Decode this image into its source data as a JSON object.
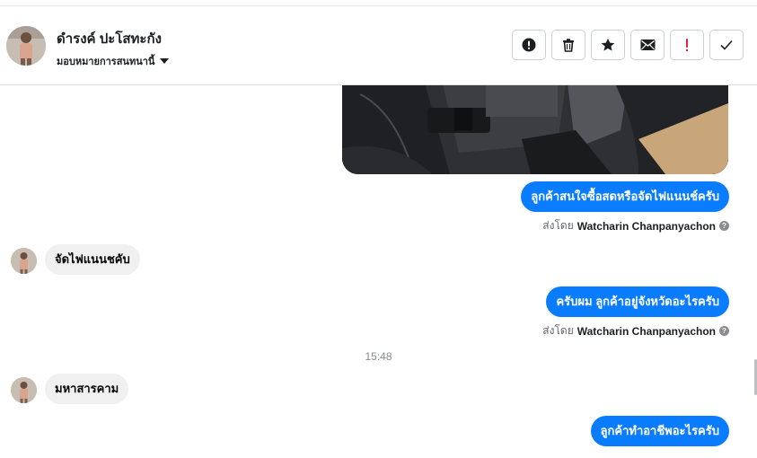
{
  "header": {
    "contact_name": "ดำรงค์ ปะโสทะกัง",
    "assign_label": "มอบหมายการสนทนานี้"
  },
  "actions": [
    {
      "icon": "alert-circle-icon",
      "label": "Mark as spam"
    },
    {
      "icon": "trash-icon",
      "label": "Delete"
    },
    {
      "icon": "star-icon",
      "label": "Star"
    },
    {
      "icon": "envelope-icon",
      "label": "Mark as unread"
    },
    {
      "icon": "exclamation-icon",
      "label": "Follow up"
    },
    {
      "icon": "checkmark-icon",
      "label": "Mark as done"
    }
  ],
  "messages": {
    "out_1": "ลูกค้าสนใจซื้อสดหรือจัดไฟแนนช์ครับ",
    "sent_by_prefix_1": "ส่งโดย",
    "sent_by_name_1": "Watcharin Chanpanyachon",
    "in_1": "จัดไฟแนนชคับ",
    "out_2": "ครับผม ลูกค้าอยู่จังหวัดอะไรครับ",
    "sent_by_prefix_2": "ส่งโดย",
    "sent_by_name_2": "Watcharin Chanpanyachon",
    "timestamp": "15:48",
    "in_2": "มหาสารคาม",
    "out_3": "ลูกค้าทำอาชีพอะไรครับ"
  },
  "colors": {
    "outgoing_bubble": "#0a7cff",
    "incoming_bubble": "#f0f0f0",
    "border": "#ccd0d5"
  }
}
